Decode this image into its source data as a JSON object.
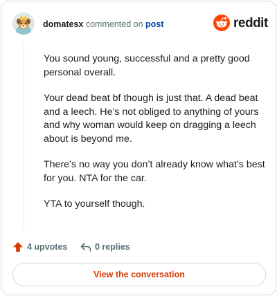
{
  "header": {
    "username": "domatesx",
    "commented_on": "commented on",
    "post_link": "post",
    "brand": "reddit",
    "brand_color": "#ff4500",
    "avatar_icon": "dog-avatar-icon"
  },
  "comment": {
    "paragraphs": [
      "You sound young, successful and a pretty good personal overall.",
      "Your dead beat bf though is just that. A dead beat and a leech. He’s not obliged to anything of yours and why woman would keep on dragging a leech about is beyond me.",
      "There’s no way you don’t already know what’s best for you. NTA for the car.",
      "YTA to yourself though."
    ]
  },
  "actions": {
    "upvotes": "4 upvotes",
    "replies": "0 replies",
    "upvote_icon": "upvote-arrow-icon",
    "reply_icon": "reply-arrow-icon"
  },
  "cta": {
    "view_conversation": "View the conversation",
    "color": "#d93a00"
  }
}
